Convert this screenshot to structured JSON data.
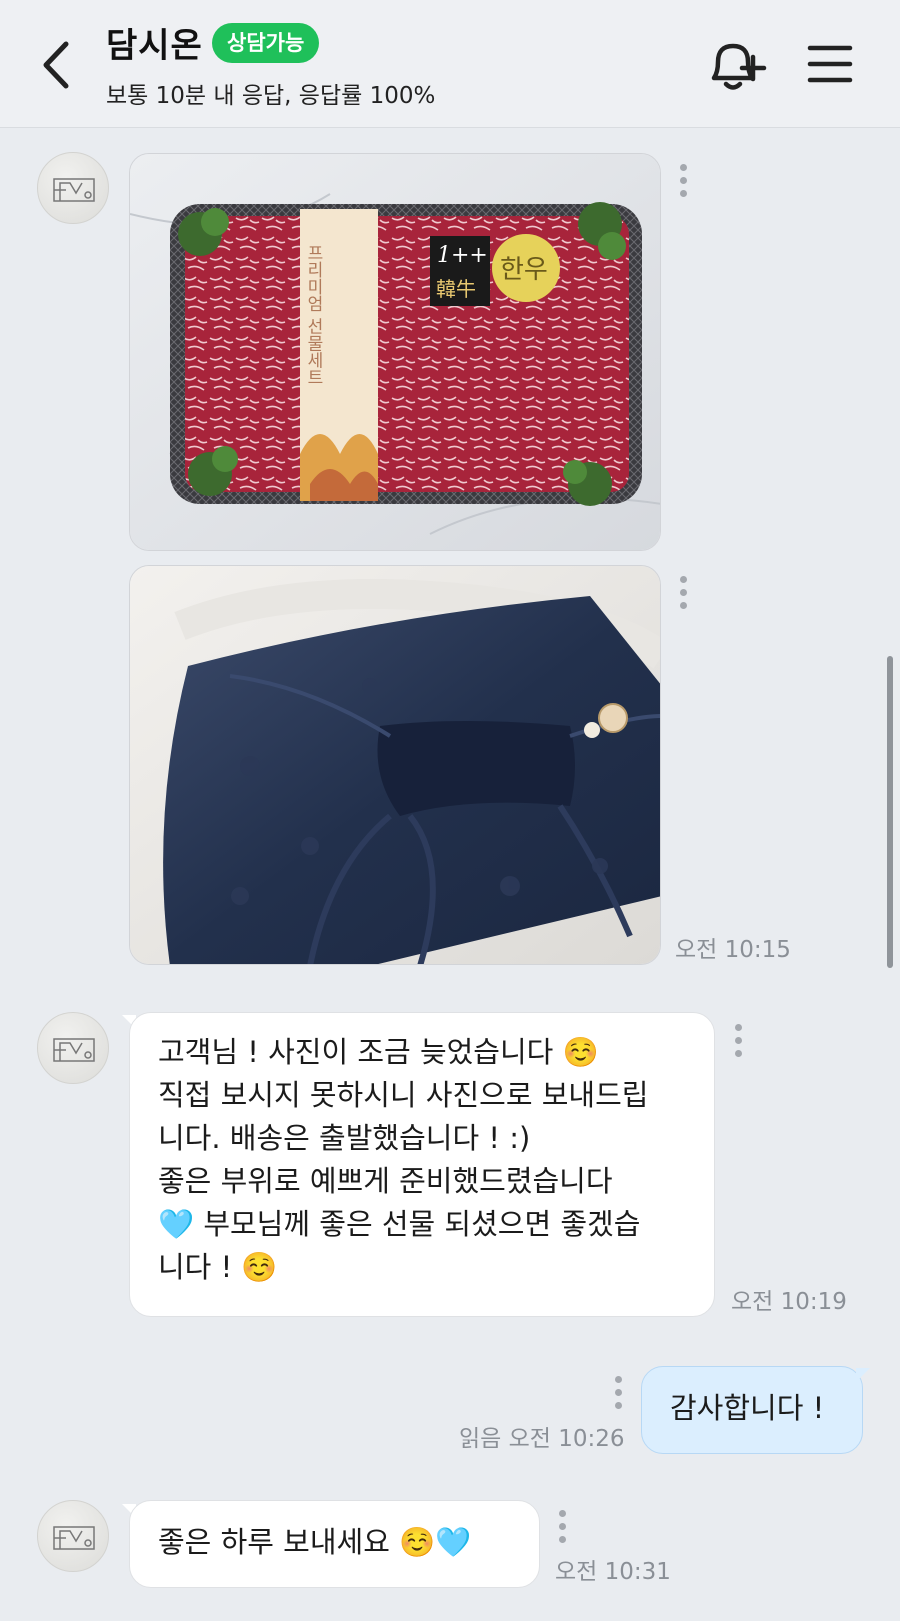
{
  "header": {
    "title": "담시온",
    "status_badge": "상담가능",
    "subtitle": "보통 10분 내 응답, 응답률 100%",
    "accent_color": "#1fc05a"
  },
  "icons": {
    "back": "chevron-left-icon",
    "notify": "bell-plus-icon",
    "menu": "hamburger-menu-icon",
    "avatar": "shop-logo-avatar",
    "more": "more-vertical-icon"
  },
  "photo1": {
    "box_label": "프리미엄 선물세트",
    "grade_label": "1++",
    "brand_label": "韓牛",
    "sticker_label": "한우"
  },
  "messages": {
    "m1_time": "오전 10:15",
    "m2_text": "고객님 ! 사진이 조금 늦었습니다 ☺️\n직접 보시지 못하시니 사진으로 보내드립\n니다. 배송은 출발했습니다 ! :)\n좋은 부위로 예쁘게 준비했드렸습니다\n🩵 부모님께 좋은 선물 되셨으면 좋겠습\n니다 ! ☺️",
    "m2_time": "오전 10:19",
    "m3_text": "감사합니다 !",
    "m3_read": "읽음",
    "m3_time": "오전 10:26",
    "m4_text": "좋은 하루 보내세요 ☺️🩵",
    "m4_time": "오전 10:31"
  }
}
